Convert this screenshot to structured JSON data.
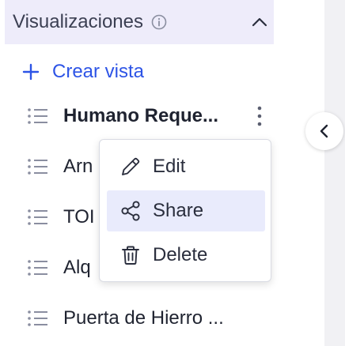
{
  "sidebar": {
    "section_title": "Visualizaciones",
    "create_view_label": "Crear vista",
    "items": [
      {
        "label": "Humano Reque..."
      },
      {
        "label": "Arn"
      },
      {
        "label": "TOI"
      },
      {
        "label": "Alq"
      },
      {
        "label": "Puerta de Hierro ..."
      }
    ]
  },
  "context_menu": {
    "items": [
      {
        "label": "Edit",
        "icon": "pencil-icon"
      },
      {
        "label": "Share",
        "icon": "share-icon"
      },
      {
        "label": "Delete",
        "icon": "trash-icon"
      }
    ]
  },
  "colors": {
    "accent": "#2d54e6",
    "header_bg": "#eeecfa",
    "menu_hover": "#e9ebfc"
  }
}
